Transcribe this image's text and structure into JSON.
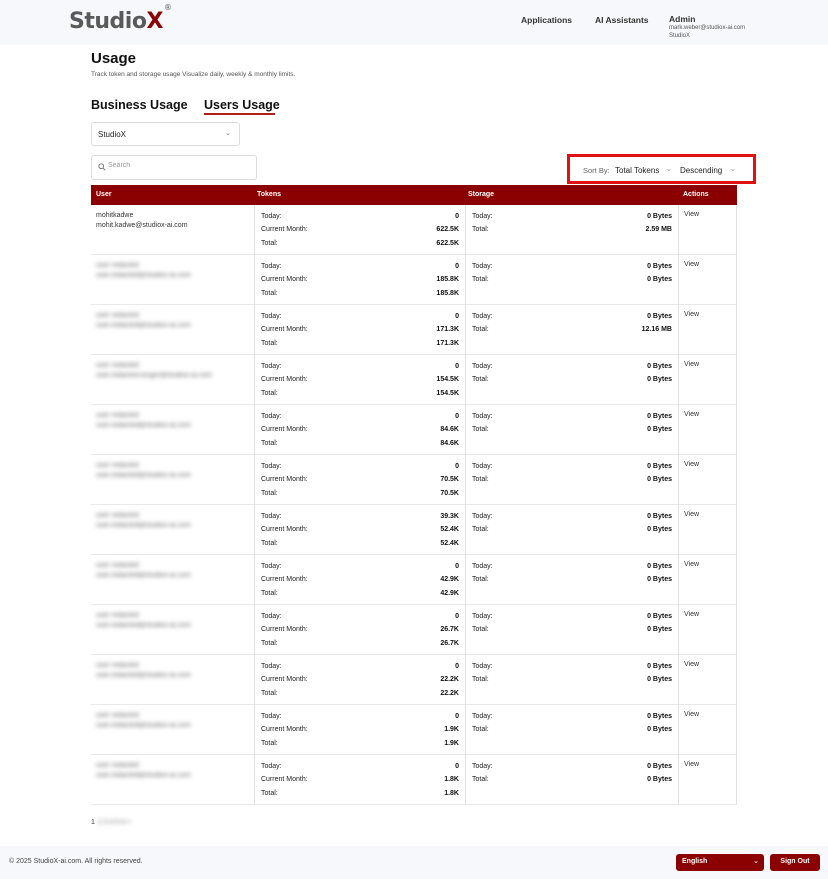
{
  "header": {
    "logo_main": "Studio",
    "logo_x": "X",
    "logo_mark": "®",
    "nav": [
      {
        "label": "Applications"
      },
      {
        "label": "AI Assistants"
      }
    ],
    "admin": {
      "name": "Admin",
      "email": "mark.weber@studiox-ai.com",
      "org": "StudioX"
    }
  },
  "page": {
    "title": "Usage",
    "subtitle": "Track token and storage usage Visualize daily, weekly & monthly limits."
  },
  "tabs": [
    {
      "label": "Business Usage",
      "active": false
    },
    {
      "label": "Users Usage",
      "active": true
    }
  ],
  "org_select": {
    "value": "StudioX"
  },
  "search": {
    "placeholder": "Search",
    "value": ""
  },
  "sort": {
    "label": "Sort By:",
    "field": "Total Tokens",
    "order": "Descending"
  },
  "table": {
    "columns": [
      "User",
      "Tokens",
      "Storage",
      "Actions"
    ],
    "token_labels": [
      "Today:",
      "Current Month:",
      "Total:"
    ],
    "storage_labels": [
      "Today:",
      "Total:"
    ],
    "action_label": "View",
    "rows": [
      {
        "name": "mohitkadwe",
        "email": "mohit.kadwe@studiox-ai.com",
        "blurred": false,
        "tokens": {
          "today": "0",
          "month": "622.5K",
          "total": "622.5K"
        },
        "storage": {
          "today": "0 Bytes",
          "total": "2.59 MB"
        }
      },
      {
        "name": "user redacted",
        "email": "user.redacted@studiox-ai.com",
        "blurred": true,
        "tokens": {
          "today": "0",
          "month": "185.8K",
          "total": "185.8K"
        },
        "storage": {
          "today": "0 Bytes",
          "total": "0 Bytes"
        }
      },
      {
        "name": "user redacted",
        "email": "user.redacted@studiox-ai.com",
        "blurred": true,
        "tokens": {
          "today": "0",
          "month": "171.3K",
          "total": "171.3K"
        },
        "storage": {
          "today": "0 Bytes",
          "total": "12.16 MB"
        }
      },
      {
        "name": "user redacted",
        "email": "user.redacted.longer@studiox-ai.com",
        "blurred": true,
        "tokens": {
          "today": "0",
          "month": "154.5K",
          "total": "154.5K"
        },
        "storage": {
          "today": "0 Bytes",
          "total": "0 Bytes"
        }
      },
      {
        "name": "user redacted",
        "email": "user.redacted@studiox-ai.com",
        "blurred": true,
        "tokens": {
          "today": "0",
          "month": "84.6K",
          "total": "84.6K"
        },
        "storage": {
          "today": "0 Bytes",
          "total": "0 Bytes"
        }
      },
      {
        "name": "user redacted",
        "email": "user.redacted@studiox-ai.com",
        "blurred": true,
        "tokens": {
          "today": "0",
          "month": "70.5K",
          "total": "70.5K"
        },
        "storage": {
          "today": "0 Bytes",
          "total": "0 Bytes"
        }
      },
      {
        "name": "user redacted",
        "email": "user.redacted@studiox-ai.com",
        "blurred": true,
        "tokens": {
          "today": "39.3K",
          "month": "52.4K",
          "total": "52.4K"
        },
        "storage": {
          "today": "0 Bytes",
          "total": "0 Bytes"
        }
      },
      {
        "name": "user redacted",
        "email": "user.redacted@studiox-ai.com",
        "blurred": true,
        "tokens": {
          "today": "0",
          "month": "42.9K",
          "total": "42.9K"
        },
        "storage": {
          "today": "0 Bytes",
          "total": "0 Bytes"
        }
      },
      {
        "name": "user redacted",
        "email": "user.redacted@studiox-ai.com",
        "blurred": true,
        "tokens": {
          "today": "0",
          "month": "26.7K",
          "total": "26.7K"
        },
        "storage": {
          "today": "0 Bytes",
          "total": "0 Bytes"
        }
      },
      {
        "name": "user redacted",
        "email": "user.redacted@studiox-ai.com",
        "blurred": true,
        "tokens": {
          "today": "0",
          "month": "22.2K",
          "total": "22.2K"
        },
        "storage": {
          "today": "0 Bytes",
          "total": "0 Bytes"
        }
      },
      {
        "name": "user redacted",
        "email": "user.redacted@studiox-ai.com",
        "blurred": true,
        "tokens": {
          "today": "0",
          "month": "1.9K",
          "total": "1.9K"
        },
        "storage": {
          "today": "0 Bytes",
          "total": "0 Bytes"
        }
      },
      {
        "name": "user redacted",
        "email": "user.redacted@studiox-ai.com",
        "blurred": true,
        "tokens": {
          "today": "0",
          "month": "1.8K",
          "total": "1.8K"
        },
        "storage": {
          "today": "0 Bytes",
          "total": "0 Bytes"
        }
      }
    ]
  },
  "pagination": {
    "current": "1",
    "rest": "2 3 4 5 6 >"
  },
  "footer": {
    "copyright": "© 2025 StudioX-ai.com.  All rights reserved.",
    "language": "English",
    "signout": "Sign Out"
  },
  "colors": {
    "brand": "#8b0000",
    "highlight": "#e01111"
  }
}
